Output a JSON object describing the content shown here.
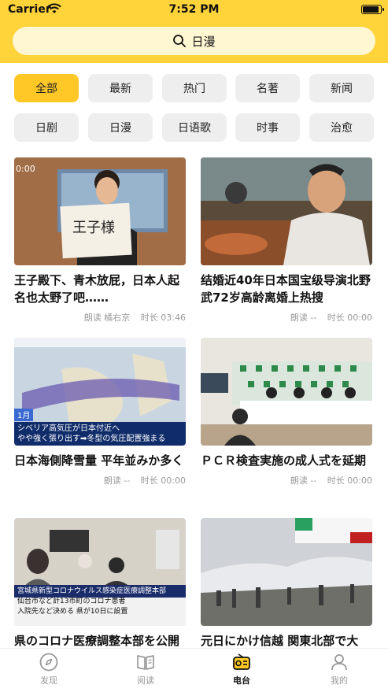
{
  "status_bar": {
    "carrier": "Carrier",
    "time": "7:52 PM"
  },
  "search": {
    "query": "日漫"
  },
  "categories": [
    {
      "label": "全部",
      "active": true
    },
    {
      "label": "最新"
    },
    {
      "label": "热门"
    },
    {
      "label": "名著"
    },
    {
      "label": "新闻"
    },
    {
      "label": "日剧"
    },
    {
      "label": "日漫"
    },
    {
      "label": "日语歌"
    },
    {
      "label": "时事"
    },
    {
      "label": "治愈"
    }
  ],
  "articles": [
    {
      "title": "王子殿下、青木放屁，日本人起名也太野了吧……",
      "reader": "朗读 橘右京",
      "duration": "时长 03:46",
      "thumb_overlay": "0:00",
      "thumb_sign": "王子様"
    },
    {
      "title": "结婚近40年日本国宝级导演北野武72岁高龄离婚上热搜",
      "reader": "朗读 --",
      "duration": "时长 00:00"
    },
    {
      "title": "日本海側降雪量 平年並みか多く",
      "reader": "朗读 --",
      "duration": "时长 00:00",
      "thumb_caption_1": "シベリア高気圧が日本付近へ",
      "thumb_caption_2": "やや強く張り出す➡冬型の気圧配置強まる",
      "thumb_tag": "1月"
    },
    {
      "title": "ＰＣＲ検査実施の成人式を延期",
      "reader": "朗读 --",
      "duration": "时长 00:00"
    },
    {
      "title": "県のコロナ医療調整本部を公開",
      "reader": "",
      "duration": "",
      "thumb_caption_1": "宮城県新型コロナウイルス感染症医療調整本部",
      "thumb_caption_2": "仙台市など計13市町のコロナ患者",
      "thumb_caption_3": "入院先など決める 県が10日に設置"
    },
    {
      "title": "元日にかけ信越 関東北部で大",
      "reader": "",
      "duration": ""
    }
  ],
  "tabbar": [
    {
      "label": "发现",
      "icon": "compass-icon"
    },
    {
      "label": "阅读",
      "icon": "book-icon"
    },
    {
      "label": "电台",
      "icon": "radio-icon",
      "active": true
    },
    {
      "label": "我的",
      "icon": "person-icon"
    }
  ],
  "colors": {
    "accent": "#FFD33A",
    "chip_active": "#FFC826",
    "chip_bg": "#EEEEEE"
  }
}
